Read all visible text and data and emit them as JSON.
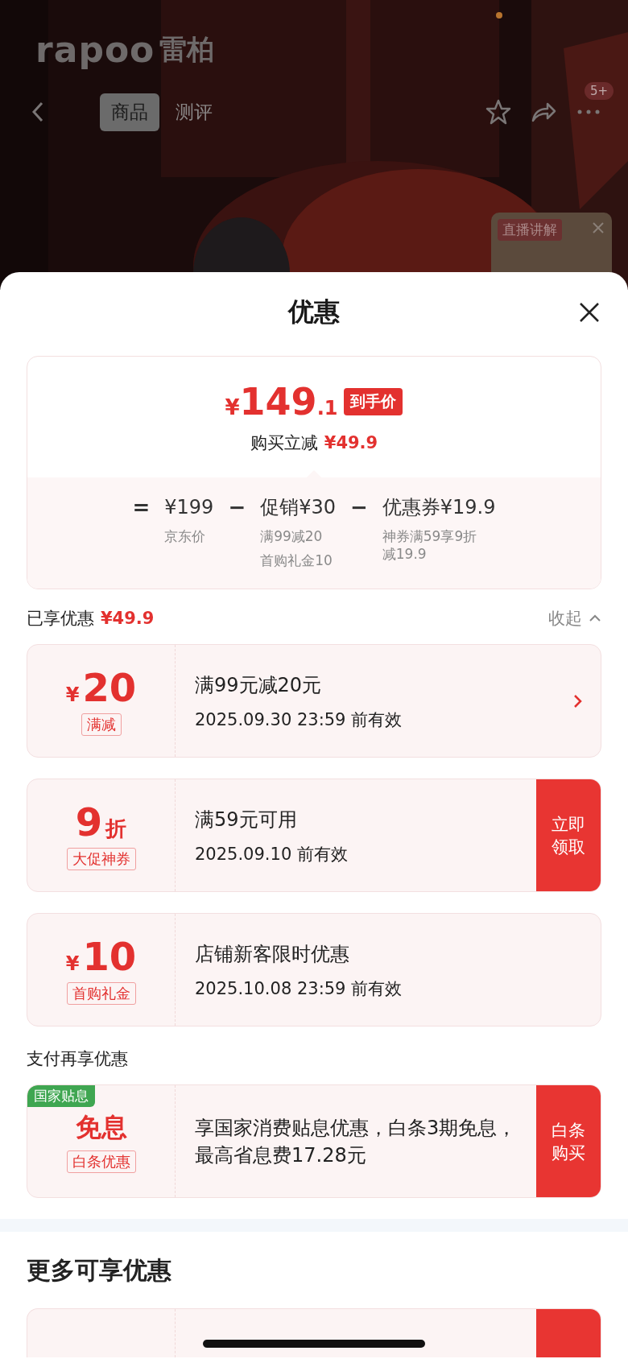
{
  "header": {
    "logo_latin": "rapoo",
    "logo_cjk": "雷柏",
    "tabs": [
      {
        "label": "商品",
        "selected": true
      },
      {
        "label": "测评",
        "selected": false
      }
    ],
    "badge": "5+",
    "live": {
      "label": "直播讲解"
    }
  },
  "sheet": {
    "title": "优惠",
    "price": {
      "currency": "¥",
      "integer": "149",
      "decimal": ".1",
      "label": "到手价",
      "savings_label": "购买立减",
      "savings": "¥49.9"
    },
    "breakdown": [
      {
        "kind": "op",
        "text": "="
      },
      {
        "kind": "term",
        "value": "¥199",
        "notes": [
          "京东价"
        ]
      },
      {
        "kind": "op",
        "text": "−"
      },
      {
        "kind": "term",
        "value": "促销¥30",
        "notes": [
          "满99减20",
          "首购礼金10"
        ]
      },
      {
        "kind": "op",
        "text": "−"
      },
      {
        "kind": "term",
        "value": "优惠券¥19.9",
        "notes": [
          "神券满59享9折减19.9"
        ]
      }
    ],
    "enjoyed": {
      "label": "已享优惠",
      "amount": "¥49.9",
      "toggle": "收起"
    },
    "coupons": [
      {
        "kind": "amount",
        "prefix": "¥",
        "value": "20",
        "tag": "满减",
        "title": "满99元减20元",
        "expiry": "2025.09.30 23:59 前有效",
        "arrow": true
      },
      {
        "kind": "discount",
        "value": "9",
        "suffix": "折",
        "tag": "大促神券",
        "title": "满59元可用",
        "expiry": "2025.09.10 前有效",
        "arrow": false,
        "button": "立即领取"
      },
      {
        "kind": "amount",
        "prefix": "¥",
        "value": "10",
        "tag": "首购礼金",
        "title": "店铺新客限时优惠",
        "expiry": "2025.10.08 23:59 前有效",
        "arrow": false
      }
    ],
    "pay_section": "支付再享优惠",
    "pay_coupons": [
      {
        "kind": "text",
        "value": "免息",
        "tag": "白条优惠",
        "corner": "国家贴息",
        "title": "享国家消费贴息优惠，白条3期免息，最高省息费17.28元",
        "arrow": false,
        "button": "白条购买"
      }
    ],
    "more_section": "更多可享优惠"
  }
}
